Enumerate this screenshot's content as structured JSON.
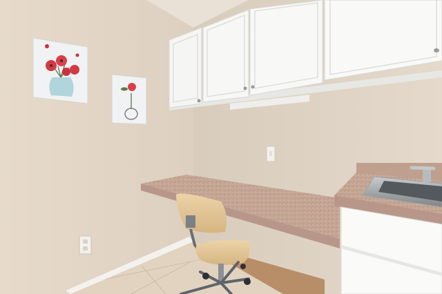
{
  "scene": {
    "subject": "room-interior",
    "elements": [
      "poppy-painting",
      "single-flower-painting",
      "upper-cabinets",
      "granite-desk",
      "office-chair",
      "sink-counter",
      "light-switch",
      "wall-outlet",
      "baseboard",
      "tile-floor"
    ]
  },
  "colors": {
    "left_wall": "#e2d6c8",
    "back_wall": "#ddd2c3",
    "cabinet": "#f7f7f5",
    "granite": "#c9aa98",
    "chair_seat": "#e4c89a",
    "floor_tile": "#e2d3c0",
    "flower_red": "#d23a44"
  }
}
